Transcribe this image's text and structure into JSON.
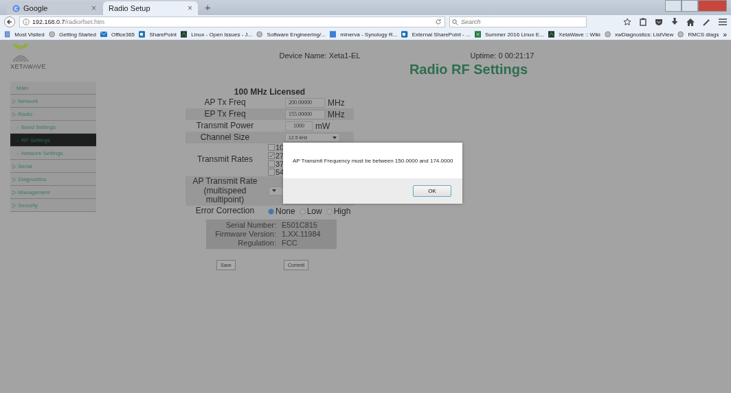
{
  "browser": {
    "tabs": [
      {
        "label": "Google",
        "selected": false,
        "close": "×"
      },
      {
        "label": "Radio Setup",
        "selected": true,
        "close": "×"
      }
    ],
    "new_tab": "+",
    "address": {
      "host": "192.168.0.7",
      "path": "/radiorfset.htm"
    },
    "search": {
      "placeholder": "Search"
    },
    "bookmarks": [
      {
        "label": "Most Visited"
      },
      {
        "label": "Getting Started"
      },
      {
        "label": "Office365"
      },
      {
        "label": "SharePoint"
      },
      {
        "label": "Linux - Open Issues - J..."
      },
      {
        "label": "Software Engineering/..."
      },
      {
        "label": "minerva - Synology R..."
      },
      {
        "label": "External SharePoint - ..."
      },
      {
        "label": "Summer 2016 Linux E..."
      },
      {
        "label": "XetaWave :: Wiki"
      },
      {
        "label": "xwDiagnostics: ListView"
      },
      {
        "label": "RMCS diags"
      }
    ],
    "overflow": "»"
  },
  "sidebar": {
    "logo": "XETAWAVE",
    "items": [
      {
        "label": "Main",
        "marker": "",
        "selected": false
      },
      {
        "label": "Network",
        "marker": "▷",
        "selected": false
      },
      {
        "label": "Radio",
        "marker": "▷",
        "selected": false,
        "children": [
          {
            "label": "Band Settings",
            "marker": "-",
            "selected": false
          },
          {
            "label": "RF Settings",
            "marker": "-",
            "selected": true
          },
          {
            "label": "Network Settings",
            "marker": "-",
            "selected": false
          }
        ]
      },
      {
        "label": "Serial",
        "marker": "▷",
        "selected": false
      },
      {
        "label": "Diagnostics",
        "marker": "▷",
        "selected": false
      },
      {
        "label": "Management",
        "marker": "▷",
        "selected": false
      },
      {
        "label": "Security",
        "marker": "▷",
        "selected": false
      }
    ]
  },
  "header": {
    "device_name": "Device Name: Xeta1-EL",
    "uptime": "Uptime: 0 00:21:17",
    "title": "Radio RF Settings"
  },
  "form": {
    "section": "100 MHz Licensed",
    "rows": [
      {
        "kind": "text",
        "label": "AP Tx Freq",
        "value": "200.00000",
        "unit": "MHz"
      },
      {
        "kind": "text",
        "label": "EP Tx Freq",
        "value": "155.00000",
        "unit": "MHz"
      },
      {
        "kind": "text",
        "label": "Transmit Power",
        "value": "1000",
        "unit": "mW"
      },
      {
        "kind": "select",
        "label": "Channel Size",
        "value": "12.5 kHz"
      },
      {
        "kind": "checks",
        "label": "Transmit Rates",
        "options": [
          {
            "label": "10",
            "checked": false
          },
          {
            "label": "27",
            "checked": true
          },
          {
            "label": "37",
            "checked": false
          },
          {
            "label": "54",
            "checked": false
          }
        ]
      },
      {
        "kind": "select",
        "label": "AP Transmit Rate (multispeed multipoint)",
        "value": ""
      },
      {
        "kind": "radios",
        "label": "Error Correction",
        "options": [
          {
            "label": "None",
            "selected": true
          },
          {
            "label": "Low",
            "selected": false
          },
          {
            "label": "High",
            "selected": false
          }
        ]
      }
    ],
    "info": [
      {
        "label": "Serial Number:",
        "value": "E501C815"
      },
      {
        "label": "Firmware Version:",
        "value": "1.XX.11984"
      },
      {
        "label": "Regulation:",
        "value": "FCC"
      }
    ],
    "buttons": [
      "Save",
      "Commit"
    ]
  },
  "dialog": {
    "message": "AP Transmit Frequency must be between 150.0000 and 174.0000",
    "button": "OK"
  }
}
